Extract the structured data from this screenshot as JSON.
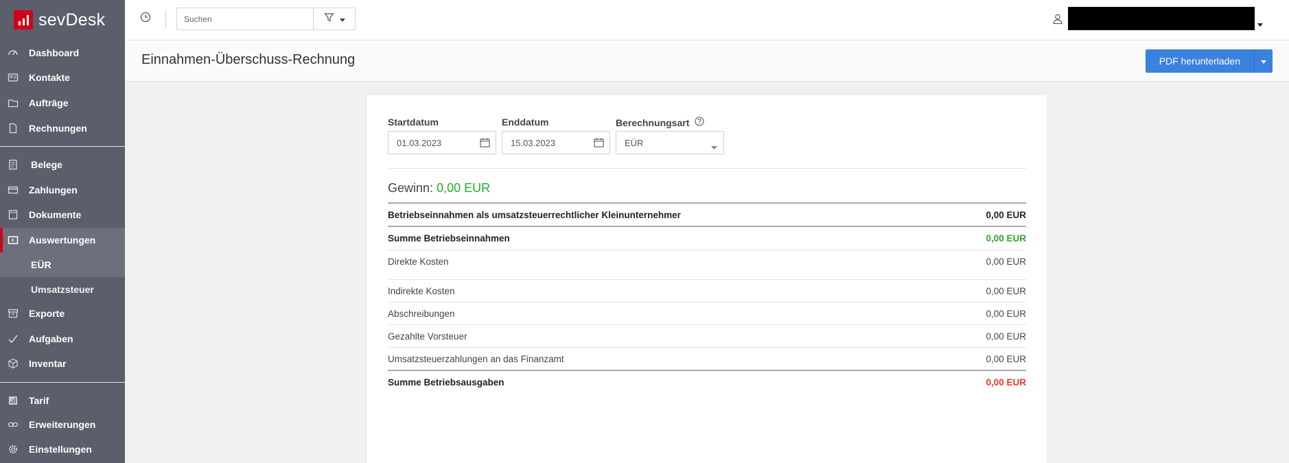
{
  "app": {
    "name": "sevDesk"
  },
  "sidebar": {
    "items": [
      {
        "label": "Dashboard"
      },
      {
        "label": "Kontakte"
      },
      {
        "label": "Aufträge"
      },
      {
        "label": "Rechnungen"
      },
      {
        "label": "Belege"
      },
      {
        "label": "Zahlungen"
      },
      {
        "label": "Dokumente"
      },
      {
        "label": "Auswertungen"
      },
      {
        "label": "Exporte"
      },
      {
        "label": "Aufgaben"
      },
      {
        "label": "Inventar"
      },
      {
        "label": "Tarif"
      },
      {
        "label": "Erweiterungen"
      },
      {
        "label": "Einstellungen"
      }
    ],
    "subitems": [
      {
        "label": "EÜR",
        "selected": true
      },
      {
        "label": "Umsatzsteuer",
        "selected": false
      }
    ]
  },
  "topbar": {
    "search_placeholder": "Suchen"
  },
  "page": {
    "title": "Einnahmen-Überschuss-Rechnung",
    "pdf_button": "PDF herunterladen"
  },
  "form": {
    "start_label": "Startdatum",
    "start_value": "01.03.2023",
    "end_label": "Enddatum",
    "end_value": "15.03.2023",
    "calc_label": "Berechnungsart",
    "calc_value": "EÜR"
  },
  "report": {
    "profit_label": "Gewinn:",
    "profit_value": "0,00 EUR",
    "rows": [
      {
        "label": "Betriebseinnahmen als umsatzsteuerrechtlicher Kleinunternehmer",
        "value": "0,00 EUR"
      },
      {
        "label": "Summe Betriebseinnahmen",
        "value": "0,00 EUR"
      },
      {
        "label": "Direkte Kosten",
        "value": "0,00 EUR"
      },
      {
        "label": "Indirekte Kosten",
        "value": "0,00 EUR"
      },
      {
        "label": "Abschreibungen",
        "value": "0,00 EUR"
      },
      {
        "label": "Gezahlte Vorsteuer",
        "value": "0,00 EUR"
      },
      {
        "label": "Umsatzsteuerzahlungen an das Finanzamt",
        "value": "0,00 EUR"
      },
      {
        "label": "Summe Betriebsausgaben",
        "value": "0,00 EUR"
      }
    ]
  },
  "colors": {
    "brand": "#d0021b",
    "primary": "#3b82e0",
    "positive": "#2aa92a",
    "negative": "#e53935",
    "sidebar": "#5a5f6b"
  }
}
